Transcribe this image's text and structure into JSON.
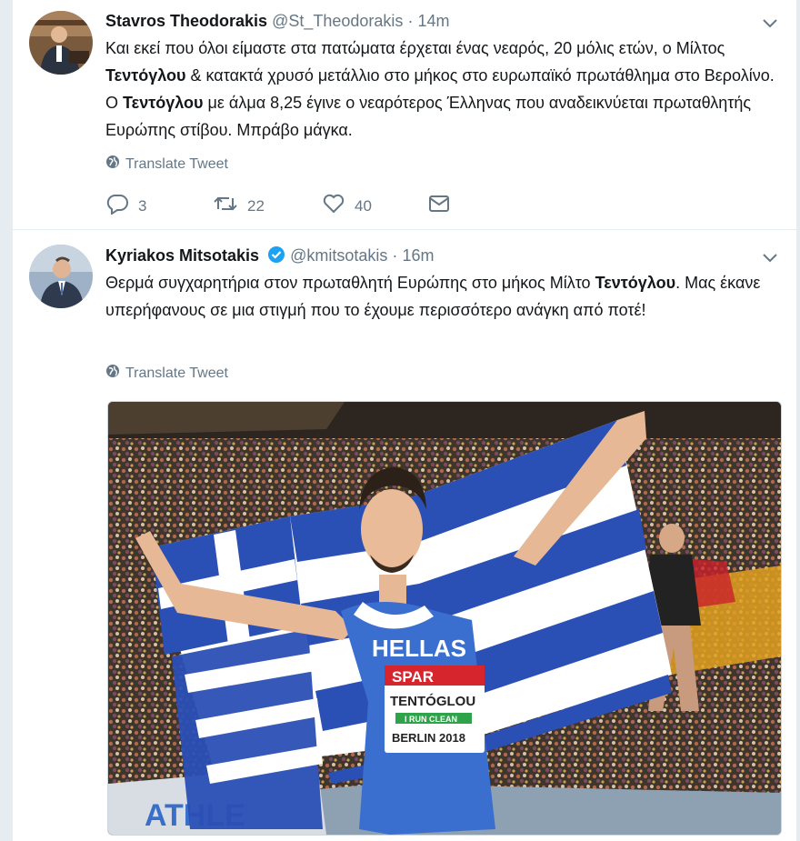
{
  "tweets": [
    {
      "name": "Stavros Theodorakis",
      "handle": "@St_Theodorakis",
      "separator": "·",
      "time": "14m",
      "text": {
        "p1": "Και εκεί που όλοι είμαστε στα πατώματα έρχεται ένας νεαρός, 20 μόλις ετών, ο Μίλτος ",
        "b1": "Τεντόγλου",
        "p2": " & κατακτά χρυσό μετάλλιο στο μήκος στο ευρωπαϊκό πρωτάθλημα στο Βερολίνο.  Ο ",
        "b2": "Τεντόγλου",
        "p3": " με άλμα 8,25 έγινε ο νεαρότερος Έλληνας που αναδεικνύεται πρωταθλητής Ευρώπης στίβου. Μπράβο μάγκα."
      },
      "translate_label": "Translate Tweet",
      "replies": "3",
      "retweets": "22",
      "likes": "40"
    },
    {
      "name": "Kyriakos Mitsotakis",
      "handle": "@kmitsotakis",
      "separator": "·",
      "time": "16m",
      "text": {
        "p1": "Θερμά συγχαρητήρια στον πρωταθλητή Ευρώπης στο μήκος Μίλτο ",
        "b1": "Τεντόγλου",
        "p2": ". Μας έκανε υπερήφανους σε μια στιγμή που το έχουμε περισσότερο ανάγκη από ποτέ!"
      },
      "translate_label": "Translate Tweet",
      "photo": {
        "jersey_team": "HELLAS",
        "bib_sponsor": "SPAR",
        "bib_name": "TENTÓGLOU",
        "bib_tagline": "I RUN CLEAN",
        "bib_event": "BERLIN 2018",
        "banner_text": "ATHLE"
      }
    }
  ],
  "colors": {
    "background": "#e6ecf0",
    "text": "#14171a",
    "secondary": "#657786",
    "verified": "#1da1f2",
    "flag_blue": "#2a4fb5"
  },
  "icons": [
    "chevron-down-icon",
    "globe-icon",
    "reply-icon",
    "retweet-icon",
    "heart-icon",
    "message-icon",
    "verified-badge-icon"
  ]
}
